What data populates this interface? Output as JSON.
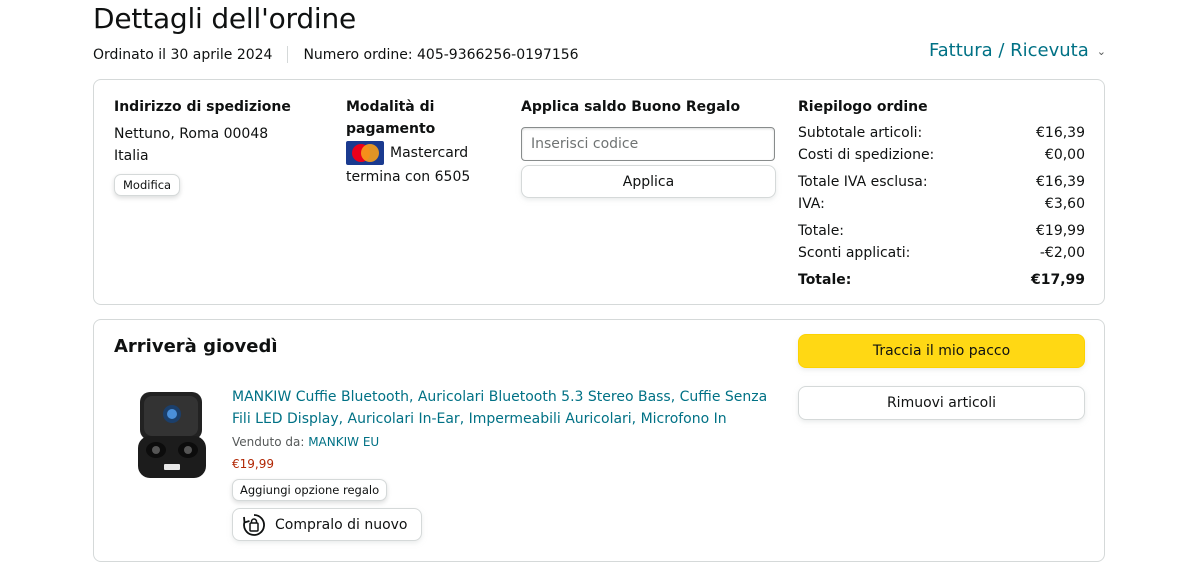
{
  "header": {
    "title": "Dettagli dell'ordine",
    "ordered_on": "Ordinato il 30 aprile 2024",
    "order_number": "Numero ordine: 405-9366256-0197156",
    "invoice_label": "Fattura / Ricevuta"
  },
  "shipping": {
    "title": "Indirizzo di spedizione",
    "line1": "Nettuno, Roma 00048",
    "line2": "Italia",
    "edit_label": "Modifica"
  },
  "payment": {
    "title": "Modalità di pagamento",
    "card_icon": "mastercard-icon",
    "card_name": "Mastercard",
    "card_end": "termina con 6505"
  },
  "gift_card": {
    "title": "Applica saldo Buono Regalo",
    "placeholder": "Inserisci codice",
    "apply_label": "Applica"
  },
  "summary": {
    "title": "Riepilogo ordine",
    "rows": [
      {
        "label": "Subtotale articoli:",
        "value": "€16,39"
      },
      {
        "label": "Costi di spedizione:",
        "value": "€0,00"
      },
      {
        "label": "Totale IVA esclusa:",
        "value": "€16,39"
      },
      {
        "label": "IVA:",
        "value": "€3,60"
      },
      {
        "label": "Totale:",
        "value": "€19,99"
      },
      {
        "label": "Sconti applicati:",
        "value": "-€2,00"
      },
      {
        "label": "Totale:",
        "value": "€17,99"
      }
    ]
  },
  "shipment": {
    "arrival": "Arriverà giovedì",
    "track_label": "Traccia il mio pacco",
    "remove_label": "Rimuovi articoli",
    "product": {
      "title": "MANKIW Cuffie Bluetooth, Auricolari Bluetooth 5.3 Stereo Bass, Cuffie Senza Fili LED Display, Auricolari In-Ear, Impermeabili Auricolari, Microfono In",
      "sold_by_label": "Venduto da:",
      "seller": "MANKIW EU",
      "price": "€19,99",
      "gift_option_label": "Aggiungi opzione regalo",
      "buy_again_label": "Compralo di nuovo",
      "buy_again_icon": "buy-again-icon"
    }
  },
  "colors": {
    "link": "#007185",
    "price": "#b12704",
    "track_button": "#ffd814",
    "border": "#d5d9d9"
  }
}
